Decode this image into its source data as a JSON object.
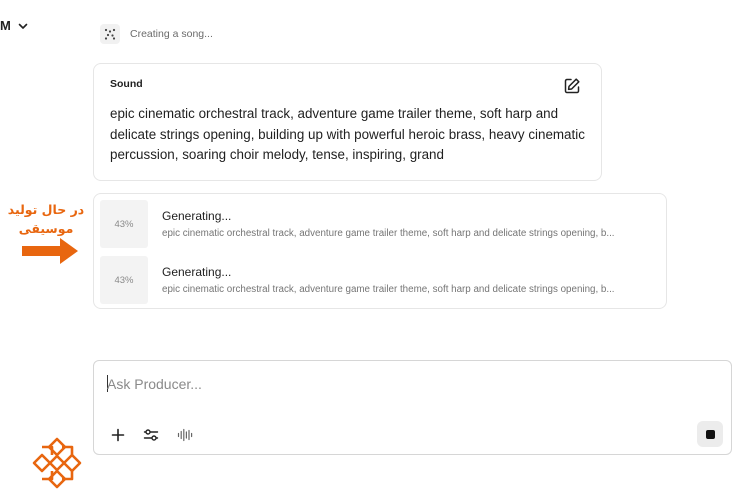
{
  "header": {
    "menu_label": "M",
    "status_text": "Creating a song..."
  },
  "sound_card": {
    "title": "Sound",
    "description": "epic cinematic orchestral track, adventure game trailer theme, soft harp and delicate strings opening, building up with powerful heroic brass, heavy cinematic percussion, soaring choir melody, tense, inspiring, grand"
  },
  "generations": [
    {
      "progress_label": "43%",
      "progress": 43,
      "title": "Generating...",
      "subtitle": "epic cinematic orchestral track, adventure game trailer theme, soft harp and delicate strings opening, b..."
    },
    {
      "progress_label": "43%",
      "progress": 43,
      "title": "Generating...",
      "subtitle": "epic cinematic orchestral track, adventure game trailer theme, soft harp and delicate strings opening, b..."
    }
  ],
  "annotation": {
    "line1": "در حال تولید",
    "line2": "موسیقی",
    "color": "#e8660f"
  },
  "composer": {
    "placeholder": "Ask Producer...",
    "value": ""
  },
  "icons": {
    "status": "dots-grid-icon",
    "edit": "edit-pencil-icon",
    "add": "plus-icon",
    "settings": "sliders-icon",
    "voice": "waveform-icon",
    "stop": "stop-square-icon",
    "logo": "ornament-logo"
  }
}
